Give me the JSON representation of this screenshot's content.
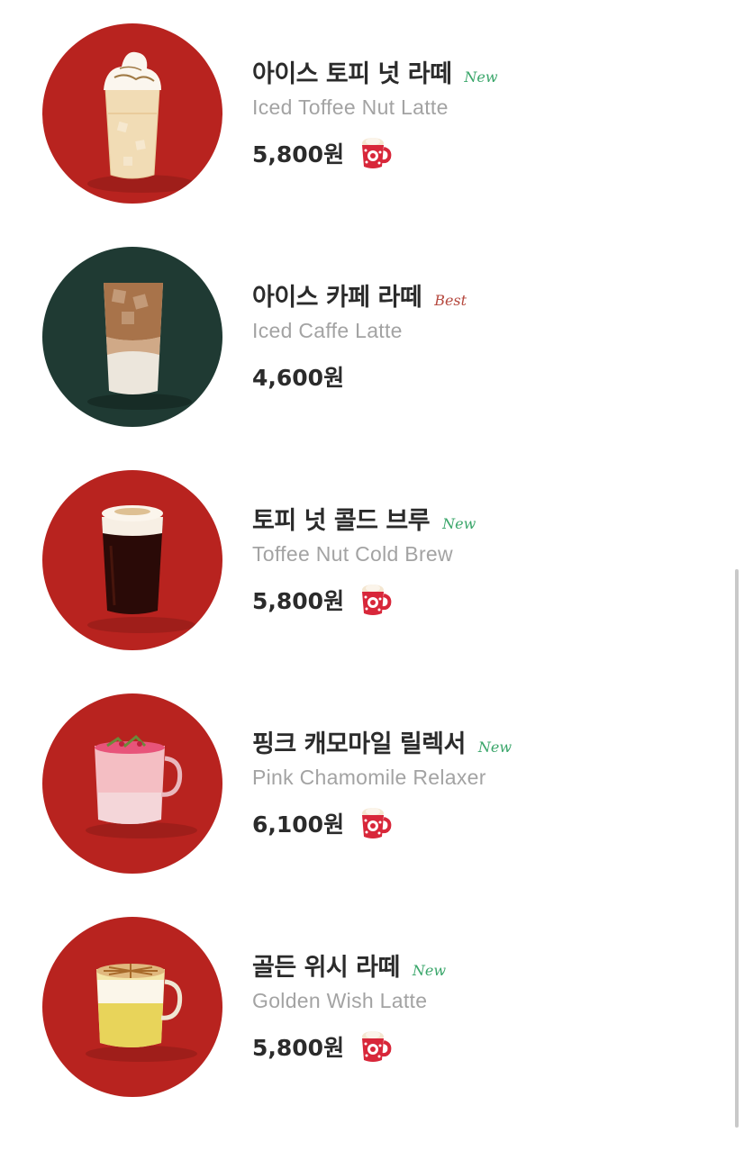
{
  "menu": {
    "items": [
      {
        "name_ko": "아이스 토피 넛 라떼",
        "badge": "New",
        "name_en": "Iced Toffee Nut Latte",
        "price": "5,800원",
        "has_holiday_mug": true,
        "bg_color": "#b8231f",
        "drink": "iced-toffee-nut-latte"
      },
      {
        "name_ko": "아이스 카페 라떼",
        "badge": "Best",
        "name_en": "Iced Caffe Latte",
        "price": "4,600원",
        "has_holiday_mug": false,
        "bg_color": "#1f3a33",
        "drink": "iced-caffe-latte"
      },
      {
        "name_ko": "토피 넛 콜드 브루",
        "badge": "New",
        "name_en": "Toffee Nut Cold Brew",
        "price": "5,800원",
        "has_holiday_mug": true,
        "bg_color": "#b8231f",
        "drink": "toffee-nut-cold-brew"
      },
      {
        "name_ko": "핑크 캐모마일 릴렉서",
        "badge": "New",
        "name_en": "Pink Chamomile Relaxer",
        "price": "6,100원",
        "has_holiday_mug": true,
        "bg_color": "#b8231f",
        "drink": "pink-chamomile-relaxer"
      },
      {
        "name_ko": "골든 위시 라떼",
        "badge": "New",
        "name_en": "Golden Wish Latte",
        "price": "5,800원",
        "has_holiday_mug": true,
        "bg_color": "#b8231f",
        "drink": "golden-wish-latte"
      }
    ]
  },
  "colors": {
    "new_badge": "#3aa66a",
    "best_badge": "#b5483e",
    "holiday_red": "#b8231f",
    "green": "#1f3a33"
  },
  "icons": {
    "holiday_mug": "holiday-mug-icon"
  }
}
